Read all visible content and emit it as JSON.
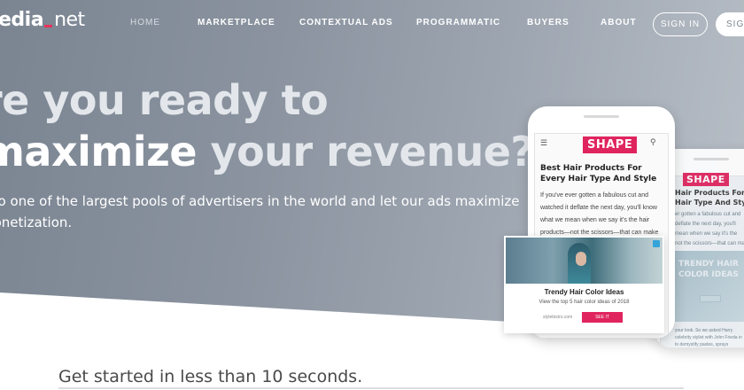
{
  "brand": {
    "logo_main": "edia",
    "logo_suffix": "net",
    "accent": "#e0245e"
  },
  "nav": {
    "items": [
      "HOME",
      "MARKETPLACE",
      "CONTEXTUAL ADS",
      "PROGRAMMATIC",
      "BUYERS",
      "ABOUT"
    ],
    "sign_in": "SIGN IN",
    "sign_up": "SIGN"
  },
  "hero": {
    "line1": "re you ready to",
    "line2_strong": "maximize",
    "line2_rest": " your revenue?",
    "sub1": "into one of the largest pools of advertisers in the world and let our ads maximize",
    "sub2": "monetization."
  },
  "phone_front": {
    "logo": "SHAPE",
    "headline": "Best Hair Products For Every Hair Type And Style",
    "body": [
      "If you've ever gotten a fabulous cut and",
      "watched it deflate the next day, you'll know",
      "what we mean when we say it's the hair",
      "products—not the scissors—that can make"
    ],
    "ad": {
      "title": "Trendy Hair Color Ideas",
      "desc": "View the top 5 hair color ideas of 2018",
      "source": "stylebistro.com",
      "button": "SEE IT"
    }
  },
  "phone_back": {
    "logo": "SHAPE",
    "headline": [
      "Hair Products For",
      "Hair Type And Style"
    ],
    "body": [
      "er gotten a fabulous cut and",
      "deflate the next day, you'll",
      "mean when we say it's the",
      "not the scissors—that can make"
    ],
    "overlay": [
      "TRENDY HAIR",
      "COLOR IDEAS"
    ],
    "tail": [
      "your look. So we asked Harry",
      "celebrity stylist with John Frieda in",
      "to demystify pastes, sprays"
    ]
  },
  "cta": {
    "text": "Get started in less than 10 seconds."
  }
}
